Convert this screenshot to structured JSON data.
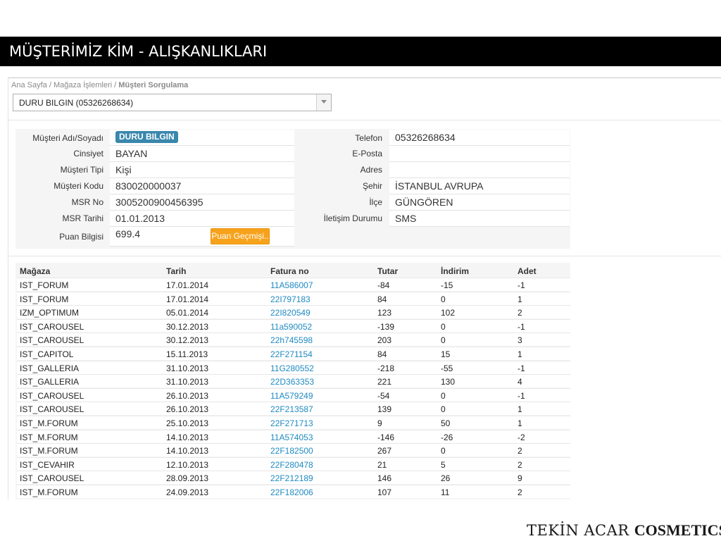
{
  "slide": {
    "title": "MÜŞTERİMİZ KİM - ALIŞKANLIKLARI",
    "logo_part1": "TEKİN ACAR ",
    "logo_part2": "COSMETICS."
  },
  "breadcrumb": {
    "home": "Ana Sayfa",
    "sep1": " / ",
    "section": "Mağaza İşlemleri",
    "sep2": " / ",
    "current": "Müşteri Sorgulama"
  },
  "customer_select": {
    "value": "DURU BILGIN (05326268634)"
  },
  "customer": {
    "labels": {
      "name": "Müşteri Adı/Soyadı",
      "gender": "Cinsiyet",
      "type": "Müşteri Tipi",
      "code": "Müşteri Kodu",
      "msr_no": "MSR No",
      "msr_date": "MSR Tarihi",
      "points": "Puan Bilgisi",
      "phone": "Telefon",
      "email": "E-Posta",
      "address": "Adres",
      "city": "Şehir",
      "district": "İlçe",
      "contact": "İletişim Durumu"
    },
    "values": {
      "name": "DURU BILGIN",
      "gender": "BAYAN",
      "type": "Kişi",
      "code": "830020000037",
      "msr_no": "3005200900456395",
      "msr_date": "01.01.2013",
      "points": "699.4",
      "phone": "05326268634",
      "email": "",
      "address": "",
      "city": "İSTANBUL AVRUPA",
      "district": "GÜNGÖREN",
      "contact": "SMS"
    },
    "points_history_button": "Puan Geçmişi.."
  },
  "purchases": {
    "columns": [
      "Mağaza",
      "Tarih",
      "Fatura no",
      "Tutar",
      "İndirim",
      "Adet"
    ],
    "rows": [
      [
        "IST_FORUM",
        "17.01.2014",
        "11A586007",
        "-84",
        "-15",
        "-1"
      ],
      [
        "IST_FORUM",
        "17.01.2014",
        "22I797183",
        "84",
        "0",
        "1"
      ],
      [
        "IZM_OPTIMUM",
        "05.01.2014",
        "22I820549",
        "123",
        "102",
        "2"
      ],
      [
        "IST_CAROUSEL",
        "30.12.2013",
        "11a590052",
        "-139",
        "0",
        "-1"
      ],
      [
        "IST_CAROUSEL",
        "30.12.2013",
        "22h745598",
        "203",
        "0",
        "3"
      ],
      [
        "IST_CAPITOL",
        "15.11.2013",
        "22F271154",
        "84",
        "15",
        "1"
      ],
      [
        "IST_GALLERIA",
        "31.10.2013",
        "11G280552",
        "-218",
        "-55",
        "-1"
      ],
      [
        "IST_GALLERIA",
        "31.10.2013",
        "22D363353",
        "221",
        "130",
        "4"
      ],
      [
        "IST_CAROUSEL",
        "26.10.2013",
        "11A579249",
        "-54",
        "0",
        "-1"
      ],
      [
        "IST_CAROUSEL",
        "26.10.2013",
        "22F213587",
        "139",
        "0",
        "1"
      ],
      [
        "IST_M.FORUM",
        "25.10.2013",
        "22F271713",
        "9",
        "50",
        "1"
      ],
      [
        "IST_M.FORUM",
        "14.10.2013",
        "11A574053",
        "-146",
        "-26",
        "-2"
      ],
      [
        "IST_M.FORUM",
        "14.10.2013",
        "22F182500",
        "267",
        "0",
        "2"
      ],
      [
        "IST_CEVAHIR",
        "12.10.2013",
        "22F280478",
        "21",
        "5",
        "2"
      ],
      [
        "IST_CAROUSEL",
        "28.09.2013",
        "22F212189",
        "146",
        "26",
        "9"
      ],
      [
        "IST_M.FORUM",
        "24.09.2013",
        "22F182006",
        "107",
        "11",
        "2"
      ]
    ]
  },
  "colors": {
    "title_bar": "#000000",
    "name_badge": "#3a87ad",
    "button": "#f7a21b",
    "link": "#1f8ac2"
  }
}
